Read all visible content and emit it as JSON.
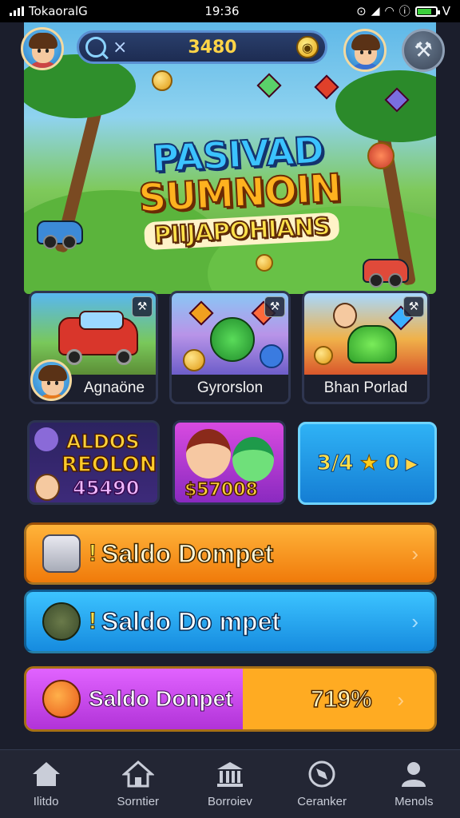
{
  "status_bar": {
    "carrier": "TokaoralG",
    "time": "19:36",
    "battery_percent": 0.8,
    "right_text": "V"
  },
  "header": {
    "search_icon": "search-icon",
    "close_symbol": "×",
    "balance": "3480",
    "coin_icon": "gold-coin-icon",
    "tools_icon": "wrench-icon"
  },
  "hero": {
    "title_line1": "PASIVAD",
    "title_line2": "SUMNOIN",
    "title_line3": "PIIJAPOHIANS"
  },
  "games": [
    {
      "label": "Agnaöne",
      "corner_icon": "crossed-tools-icon",
      "corner_symbol": "⚒"
    },
    {
      "label": "Gyrorslon",
      "corner_icon": "crossed-tools-icon",
      "corner_symbol": "⚒"
    },
    {
      "label": "Bhan Porlad",
      "corner_icon": "crossed-tools-icon",
      "corner_symbol": "⚒"
    }
  ],
  "promos": {
    "promo1_line1": "ALDOS",
    "promo1_line2": "REOLON",
    "promo1_line3": "45490",
    "promo2_amount": "$57008",
    "stat_value": "3/4",
    "stat_star": "★",
    "stat_count": "0",
    "stat_play": "▶"
  },
  "wallet": {
    "row1": {
      "bang": "!",
      "label": "Saldo Dompet",
      "chevron": "›"
    },
    "row2": {
      "bang": "!",
      "label": "Saldo Do mpet",
      "chevron": "›"
    },
    "row3": {
      "label": "Saldo Donpet",
      "percent": "719%",
      "fill_fraction": 0.53,
      "chevron": "›"
    }
  },
  "colors": {
    "orange": "#f07a0a",
    "blue": "#168bdf",
    "purple": "#b133d8",
    "gold": "#ffd447"
  },
  "nav": [
    {
      "label": "Ilitdo",
      "icon": "home-icon"
    },
    {
      "label": "Sorntier",
      "icon": "house-icon"
    },
    {
      "label": "Borroiev",
      "icon": "bank-icon"
    },
    {
      "label": "Ceranker",
      "icon": "compass-icon"
    },
    {
      "label": "Menols",
      "icon": "user-icon"
    }
  ]
}
